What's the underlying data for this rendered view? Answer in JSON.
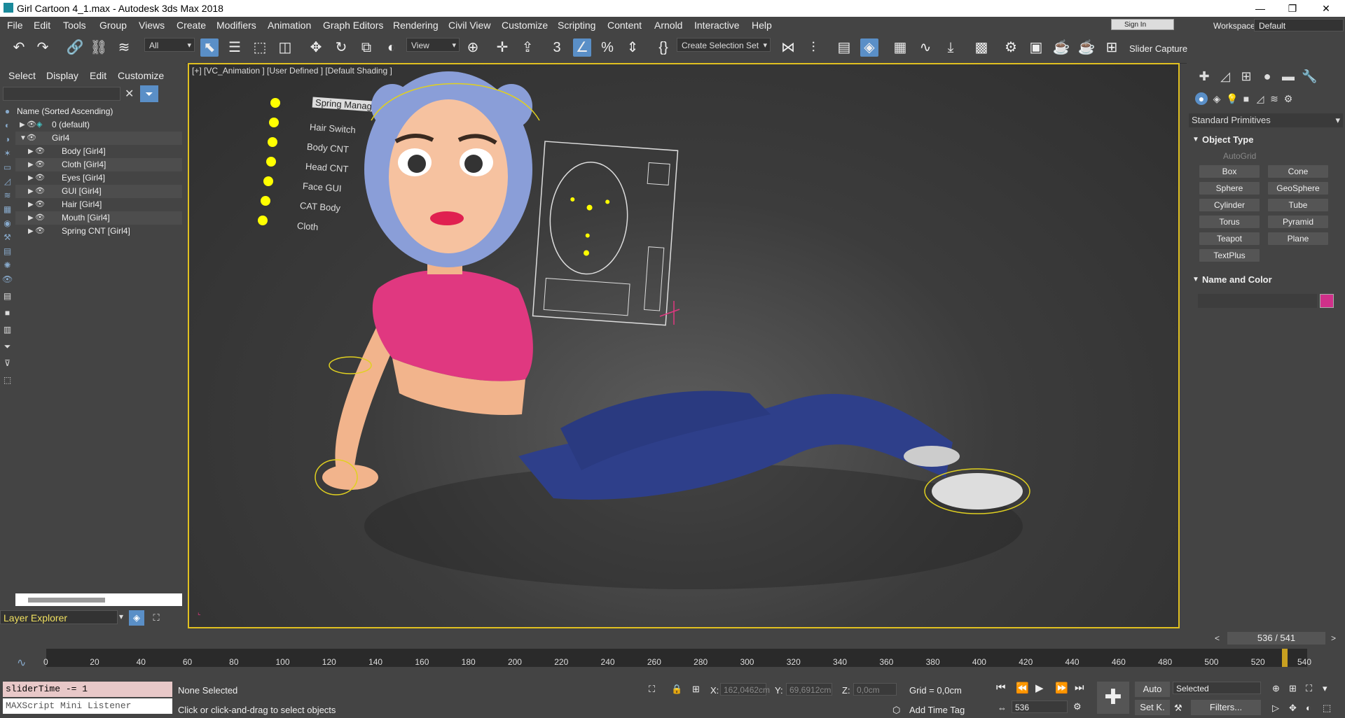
{
  "window": {
    "title": "Girl Cartoon 4_1.max - Autodesk 3ds Max 2018"
  },
  "menu": [
    "File",
    "Edit",
    "Tools",
    "Group",
    "Views",
    "Create",
    "Modifiers",
    "Animation",
    "Graph Editors",
    "Rendering",
    "Civil View",
    "Customize",
    "Scripting",
    "Content",
    "Arnold",
    "Interactive",
    "Help"
  ],
  "account": {
    "sign_in": "Sign In",
    "workspaces_label": "Workspaces:",
    "workspace": "Default"
  },
  "toolbar": {
    "filter": "All",
    "refcoord": "View",
    "selset": "Create Selection Set",
    "slider_capture": "Slider Capture"
  },
  "scene_explorer": {
    "tabs": [
      "Select",
      "Display",
      "Edit",
      "Customize"
    ],
    "column_header": "Name (Sorted Ascending)",
    "rows": [
      {
        "label": "0 (default)"
      },
      {
        "label": "Girl4"
      },
      {
        "label": "Body [Girl4]"
      },
      {
        "label": "Cloth [Girl4]"
      },
      {
        "label": "Eyes [Girl4]"
      },
      {
        "label": "GUI [Girl4]"
      },
      {
        "label": "Hair [Girl4]"
      },
      {
        "label": "Mouth [Girl4]"
      },
      {
        "label": "Spring CNT [Girl4]"
      }
    ],
    "explorer_type": "Layer Explorer"
  },
  "viewport": {
    "label": "[+] [VC_Animation ] [User Defined ] [Default Shading ]",
    "gui_controls": [
      "Spring Manager",
      "Hair Switch",
      "Body CNT",
      "Head CNT",
      "Face GUI",
      "CAT Body",
      "Cloth"
    ]
  },
  "command_panel": {
    "category": "Standard Primitives",
    "object_type_header": "Object Type",
    "autogrid": "AutoGrid",
    "primitives": [
      "Box",
      "Cone",
      "Sphere",
      "GeoSphere",
      "Cylinder",
      "Tube",
      "Torus",
      "Pyramid",
      "Teapot",
      "Plane",
      "TextPlus"
    ],
    "name_color_header": "Name and Color",
    "object_color": "#d0308a"
  },
  "timeline": {
    "frame_display": "536 / 541",
    "ticks": [
      "0",
      "20",
      "40",
      "60",
      "80",
      "100",
      "120",
      "140",
      "160",
      "180",
      "200",
      "220",
      "240",
      "260",
      "280",
      "300",
      "320",
      "340",
      "360",
      "380",
      "400",
      "420",
      "440",
      "460",
      "480",
      "500",
      "520",
      "540"
    ],
    "current_frame_fraction": 0.991
  },
  "status": {
    "maxscript_input": "sliderTime -= 1",
    "maxscript_listener": "MAXScript Mini Listener",
    "selection": "None Selected",
    "prompt": "Click or click-and-drag to select objects",
    "x_label": "X:",
    "x_value": "162,0462cm",
    "y_label": "Y:",
    "y_value": "69,6912cm",
    "z_label": "Z:",
    "z_value": "0,0cm",
    "grid": "Grid = 0,0cm",
    "add_time_tag": "Add Time Tag",
    "auto_key": "Auto",
    "set_key": "Set K.",
    "key_filter": "Selected",
    "filters": "Filters...",
    "frame_spinner": "536"
  }
}
